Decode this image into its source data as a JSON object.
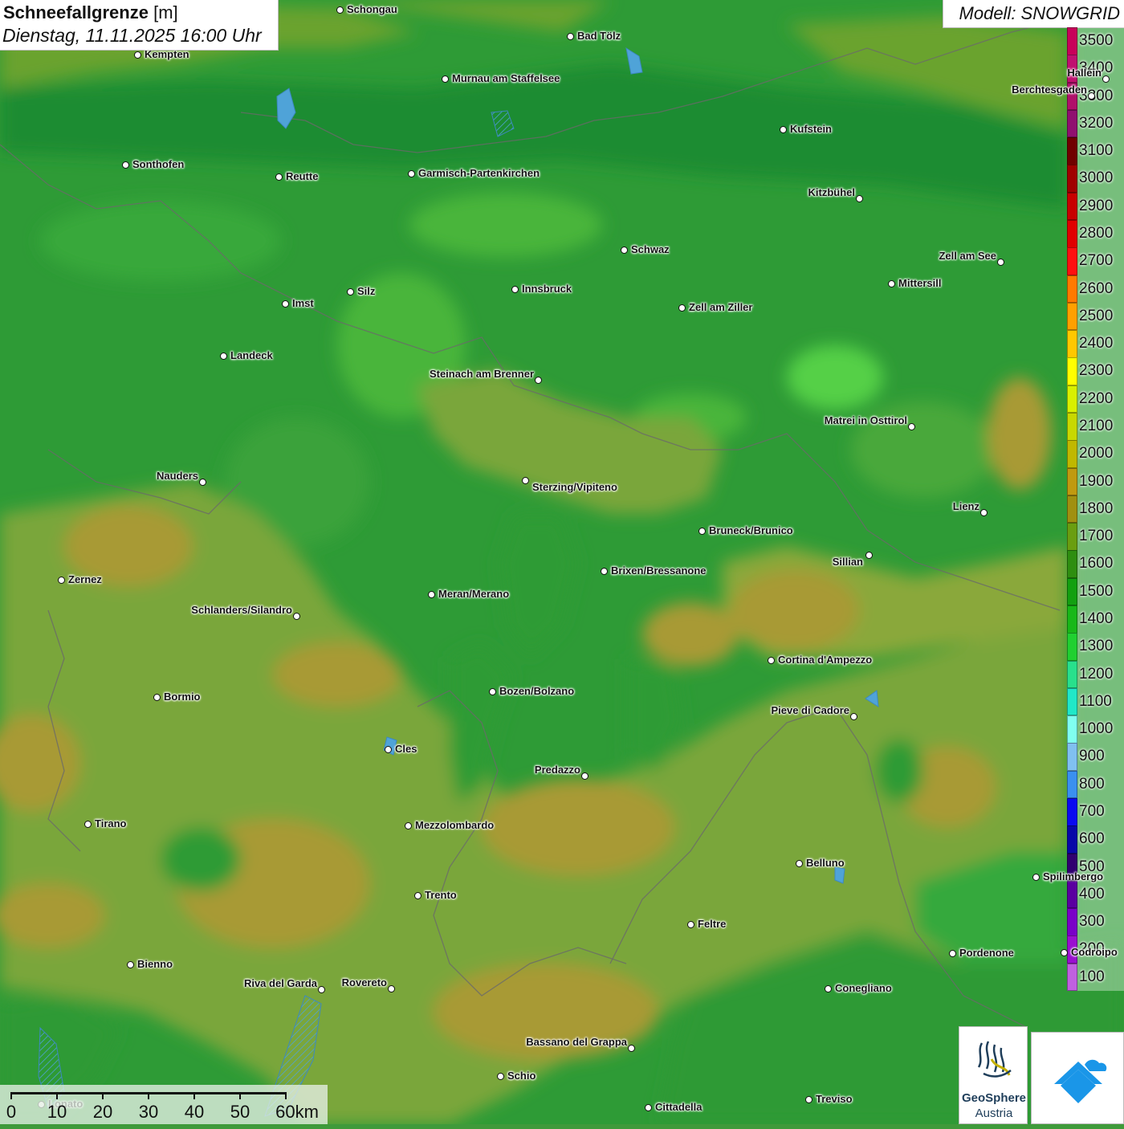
{
  "title": {
    "main": "Schneefallgrenze",
    "unit": "[m]",
    "datetime": "Dienstag, 11.11.2025 16:00 Uhr"
  },
  "model": {
    "label": "Modell: SNOWGRID"
  },
  "legend": {
    "values": [
      "3500",
      "3400",
      "3300",
      "3200",
      "3100",
      "3000",
      "2900",
      "2800",
      "2700",
      "2600",
      "2500",
      "2400",
      "2300",
      "2200",
      "2100",
      "2000",
      "1900",
      "1800",
      "1700",
      "1600",
      "1500",
      "1400",
      "1300",
      "1200",
      "1100",
      "1000",
      "900",
      "800",
      "700",
      "600",
      "500",
      "400",
      "300",
      "200",
      "100"
    ],
    "colors": [
      "#c8005a",
      "#c01070",
      "#b0106a",
      "#901070",
      "#700000",
      "#a00000",
      "#c80000",
      "#e00000",
      "#ff1010",
      "#ff7a00",
      "#ffa000",
      "#ffc800",
      "#ffff00",
      "#d8f000",
      "#c8d800",
      "#c0b800",
      "#c09a10",
      "#a09010",
      "#6a9e10",
      "#2e8e10",
      "#12a010",
      "#18b818",
      "#20d030",
      "#28e08c",
      "#20e8c8",
      "#80fff0",
      "#80c0f0",
      "#3a90f0",
      "#0a0af0",
      "#0808a8",
      "#300070",
      "#5a00a0",
      "#7a00c8",
      "#9a10d0",
      "#c060e0"
    ]
  },
  "cities": [
    {
      "name": "Schongau"
    },
    {
      "name": "Bad Tölz"
    },
    {
      "name": "Kempten"
    },
    {
      "name": "Murnau am Staffelsee"
    },
    {
      "name": "Hallein"
    },
    {
      "name": "Berchtesgaden"
    },
    {
      "name": "Kufstein"
    },
    {
      "name": "Sonthofen"
    },
    {
      "name": "Reutte"
    },
    {
      "name": "Garmisch-Partenkirchen"
    },
    {
      "name": "Kitzbühel"
    },
    {
      "name": "Schwaz"
    },
    {
      "name": "Zell am See"
    },
    {
      "name": "Mittersill"
    },
    {
      "name": "Innsbruck"
    },
    {
      "name": "Imst"
    },
    {
      "name": "Silz"
    },
    {
      "name": "Zell am Ziller"
    },
    {
      "name": "Landeck"
    },
    {
      "name": "Steinach am Brenner"
    },
    {
      "name": "Matrei in Osttirol"
    },
    {
      "name": "Nauders"
    },
    {
      "name": "Sterzing/Vipiteno"
    },
    {
      "name": "Lienz"
    },
    {
      "name": "Bruneck/Brunico"
    },
    {
      "name": "Sillian"
    },
    {
      "name": "Brixen/Bressanone"
    },
    {
      "name": "Zernez"
    },
    {
      "name": "Meran/Merano"
    },
    {
      "name": "Schlanders/Silandro"
    },
    {
      "name": "Cortina d'Ampezzo"
    },
    {
      "name": "Bozen/Bolzano"
    },
    {
      "name": "Bormio"
    },
    {
      "name": "Pieve di Cadore"
    },
    {
      "name": "Cles"
    },
    {
      "name": "Predazzo"
    },
    {
      "name": "Tirano"
    },
    {
      "name": "Mezzolombardo"
    },
    {
      "name": "Belluno"
    },
    {
      "name": "Spilimbergo"
    },
    {
      "name": "Trento"
    },
    {
      "name": "Feltre"
    },
    {
      "name": "Pordenone"
    },
    {
      "name": "Codroipo"
    },
    {
      "name": "Bienno"
    },
    {
      "name": "Riva del Garda"
    },
    {
      "name": "Rovereto"
    },
    {
      "name": "Conegliano"
    },
    {
      "name": "Bassano del Grappa"
    },
    {
      "name": "Schio"
    },
    {
      "name": "Lonato"
    },
    {
      "name": "Treviso"
    },
    {
      "name": "Cittadella"
    }
  ],
  "scale": {
    "labels": [
      "0",
      "10",
      "20",
      "30",
      "40",
      "50",
      "60km"
    ]
  },
  "logos": {
    "geosphere_name": "GeoSphere",
    "geosphere_sub": "Austria"
  }
}
